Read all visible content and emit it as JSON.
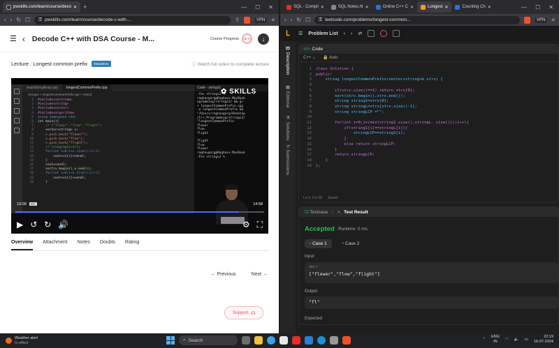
{
  "left_browser": {
    "tab_title": "pwskills.com/learn/course/deco",
    "url": "pwskills.com/learn/course/decode-c-with-...",
    "vpn": "VPN"
  },
  "right_browser": {
    "tabs": [
      {
        "title": "SQL - Compil",
        "color": "#e52d27"
      },
      {
        "title": "SQL Notes.ht",
        "color": "#888888"
      },
      {
        "title": "Online C++ C",
        "color": "#2f6fd6"
      },
      {
        "title": "Longest",
        "color": "#f89f1b"
      },
      {
        "title": "Counting Ch",
        "color": "#2f6fd6"
      }
    ],
    "url": "leetcode.com/problems/longest-common...",
    "vpn": "VPN"
  },
  "course": {
    "title": "Decode C++ with DSA Course - M...",
    "progress_label": "Course Progress",
    "progress_value": "25 %",
    "lecture": "Lecture : Longest common prefix",
    "badge": "Mandatory",
    "watch_note": "Watch full video to complete lecture"
  },
  "video": {
    "vs_tabs": [
      "mainStringArray.cpp",
      "longestCommonPrefix.cpp"
    ],
    "breadcrumb": "strings2 > longestCommonPrefix.cpp > main()",
    "code_lines": [
      {
        "n": "1",
        "t": "#include<iostream>",
        "c": "c-inc"
      },
      {
        "n": "2",
        "t": "#include<string>",
        "c": "c-inc"
      },
      {
        "n": "3",
        "t": "#include<vector>",
        "c": "c-inc"
      },
      {
        "n": "4",
        "t": "#include<algorithm>",
        "c": "c-inc"
      },
      {
        "n": "5",
        "t": "using namespace std;",
        "c": "c-kw"
      },
      {
        "n": "6",
        "t": "int main(){",
        "c": "c-tx"
      },
      {
        "n": "7",
        "t": "    // [\"flower\",\"flow\",\"flight\"]",
        "c": "c-cm"
      },
      {
        "n": "8",
        "t": "    vector<string> v;",
        "c": "c-tx"
      },
      {
        "n": "9",
        "t": "    v.push_back(\"flower\");",
        "c": "c-str"
      },
      {
        "n": "10",
        "t": "    v.push_back(\"flow\");",
        "c": "c-str"
      },
      {
        "n": "11",
        "t": "    v.push_back(\"flight\");",
        "c": "c-str"
      },
      {
        "n": "12",
        "t": "    // lexographically",
        "c": "c-cm"
      },
      {
        "n": "13",
        "t": "    for(int i=0;i<v.size();i++){",
        "c": "c-kw"
      },
      {
        "n": "14",
        "t": "        cout<<v[i]<<endl;",
        "c": "c-tx"
      },
      {
        "n": "15",
        "t": "    }",
        "c": "c-tx"
      },
      {
        "n": "16",
        "t": "    cout<<endl;",
        "c": "c-tx"
      },
      {
        "n": "17",
        "t": "    sort(v.begin(),v.end());",
        "c": "c-fn"
      },
      {
        "n": "18",
        "t": "    for(int i=0;i<v.size();i++){",
        "c": "c-kw"
      },
      {
        "n": "19",
        "t": "        cout<<v[i]<<endl;",
        "c": "c-tx"
      },
      {
        "n": "20",
        "t": "    }",
        "c": "c-tx"
      }
    ],
    "terminal_title": "Code - strings2",
    "terminal_text": "-fov strings2 %\nraghavgarg@Raghavs-MacBook\nogramming/strings2/ && g+\n+ longestCommonPrefix.cpp\n-o longestCommonPrefix &&\n\"/Users/raghavgarg/Desktop\n/C++_Programming/strings2/\n\"longestCommonPrefix\nflower\nflow\nflight\n\nflight\nflow\nflower\nraghavgarg@Raghavs-MacBook\n-Pro strings2 % ",
    "brand": "SKILLS",
    "time_current": "13:28",
    "cc": "CC",
    "time_total": "14:58",
    "progress": 0.9
  },
  "content_tabs": [
    "Overview",
    "Attachment",
    "Notes",
    "Doubts",
    "Rating"
  ],
  "pager": {
    "prev": "Previous",
    "next": "Next"
  },
  "support": "Support",
  "leetcode": {
    "problem_list": "Problem List",
    "code_label": "Code",
    "language": "C++",
    "auto": "Auto",
    "rail": [
      "Description",
      "Editorial",
      "Solutions",
      "Submissions"
    ],
    "code_lines": [
      {
        "n": "1",
        "t": "class Solution {"
      },
      {
        "n": "2",
        "t": "public:"
      },
      {
        "n": "3",
        "t": "    string longestCommonPrefix(vector<string>& strs) {"
      },
      {
        "n": "4",
        "t": ""
      },
      {
        "n": "5",
        "t": "        if(strs.size()==1) return strs[0];"
      },
      {
        "n": "6",
        "t": "        sort(strs.begin(),strs.end());"
      },
      {
        "n": "7",
        "t": "        string string1=strs[0];"
      },
      {
        "n": "8",
        "t": "        string stringL=strs[strs.size()-1];"
      },
      {
        "n": "9",
        "t": "        string stringLCP =\"\";"
      },
      {
        "n": "10",
        "t": ""
      },
      {
        "n": "11",
        "t": "        for(int i=0;i<(min(string1.size(),stringL. size()));i++){"
      },
      {
        "n": "12",
        "t": "            if(string1[i]==stringL[i]){"
      },
      {
        "n": "13",
        "t": "                stringLCP+=string1[i];"
      },
      {
        "n": "14",
        "t": "            }"
      },
      {
        "n": "15",
        "t": "            else return stringLCP;"
      },
      {
        "n": "16",
        "t": "        }"
      },
      {
        "n": "17",
        "t": "        return stringLCP;"
      },
      {
        "n": "18",
        "t": "    }"
      },
      {
        "n": "19",
        "t": "};"
      }
    ],
    "status_pos": "Ln 9, Col 28",
    "status_saved": "Saved",
    "tc_tab": "Testcase",
    "result_tab": "Test Result",
    "accepted": "Accepted",
    "runtime": "Runtime: 0 ms",
    "case1": "Case 1",
    "case2": "Case 2",
    "input_label": "Input",
    "input_var": "strs =",
    "input_value": "[\"flower\",\"flow\",\"flight\"]",
    "output_label": "Output",
    "output_value": "\"fl\"",
    "expected_label": "Expected"
  },
  "taskbar": {
    "weather_title": "Weather alert",
    "weather_sub": "In effect",
    "search": "Search",
    "lang1": "ENG",
    "lang2": "IN",
    "time": "22:19",
    "date": "16-07-2024"
  }
}
